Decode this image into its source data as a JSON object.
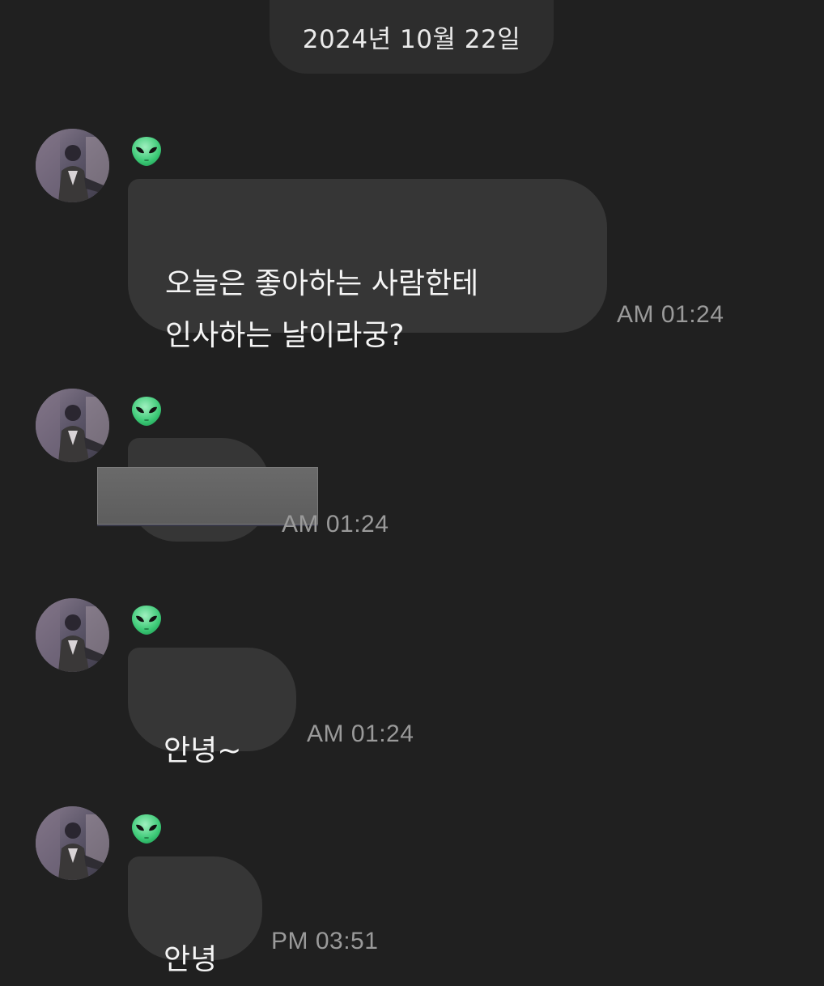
{
  "date_label": "2024년 10월 22일",
  "sender_icon": "alien-emoji",
  "messages": [
    {
      "text": "오늘은 좋아하는 사람한테\n인사하는 날이라궁?",
      "time": "AM 01:24"
    },
    {
      "text": "",
      "time": "AM 01:24",
      "redacted": true
    },
    {
      "text": "안녕~",
      "time": "AM 01:24"
    },
    {
      "text": "안녕",
      "time": "PM 03:51"
    }
  ]
}
